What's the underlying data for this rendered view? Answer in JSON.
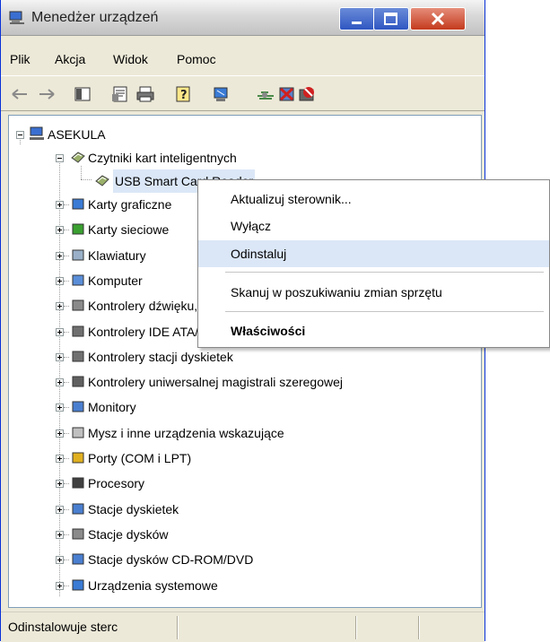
{
  "window": {
    "title": "Menedżer urządzeń"
  },
  "menu": [
    "Plik",
    "Akcja",
    "Widok",
    "Pomoc"
  ],
  "toolbar": [
    "back-icon",
    "forward-icon",
    "console-tree-icon",
    "properties-icon",
    "print-icon",
    "help-icon",
    "scan-hardware-icon",
    "update-driver-icon",
    "disable-icon",
    "uninstall-icon"
  ],
  "tree": {
    "root": "ASEKULA",
    "category_open": "Czytniki kart inteligentnych",
    "device_selected": "USB Smart Card Reader",
    "categories": [
      "Karty graficzne",
      "Karty sieciowe",
      "Klawiatury",
      "Komputer",
      "Kontrolery dźwięku, wideo i gier",
      "Kontrolery IDE ATA/ATAPI",
      "Kontrolery stacji dyskietek",
      "Kontrolery uniwersalnej magistrali szeregowej",
      "Monitory",
      "Mysz i inne urządzenia wskazujące",
      "Porty (COM i LPT)",
      "Procesory",
      "Stacje dyskietek",
      "Stacje dysków",
      "Stacje dysków CD-ROM/DVD",
      "Urządzenia systemowe"
    ]
  },
  "context_menu": {
    "items": [
      "Aktualizuj sterownik...",
      "Wyłącz",
      "Odinstaluj",
      "Skanuj w poszukiwaniu zmian sprzętu",
      "Właściwości"
    ],
    "highlighted": "Odinstaluj"
  },
  "status": {
    "text": "Odinstalowuje sterc"
  },
  "colors": {
    "highlight": "#dbe7f7",
    "title_blue": "#2f57c2",
    "close_red": "#c43a1d"
  }
}
